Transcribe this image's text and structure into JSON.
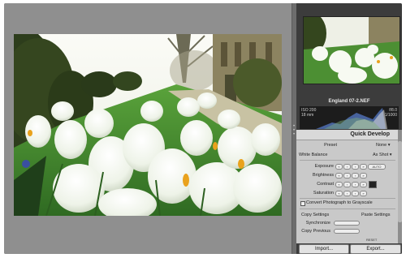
{
  "navigator": {
    "filename": "England 07-2.NEF"
  },
  "histogram": {
    "iso": "ISO 200",
    "focal": "18 mm",
    "aperture": "f/8.0",
    "shutter": "1/1000"
  },
  "quick_develop": {
    "title": "Quick Develop",
    "preset_label": "Preset",
    "preset_value": "None",
    "white_balance_label": "White Balance",
    "white_balance_value": "As Shot",
    "exposure_label": "Exposure",
    "brightness_label": "Brightness",
    "contrast_label": "Contrast",
    "saturation_label": "Saturation",
    "auto_label": "AUTO",
    "grayscale_label": "Convert Photograph to Grayscale",
    "copy_settings_label": "Copy Settings",
    "paste_settings_label": "Paste Settings",
    "synchronize_label": "Synchronize",
    "copy_previous_label": "Copy Previous",
    "reset_label": "RESET"
  },
  "buttons": {
    "import": "Import...",
    "export": "Export..."
  },
  "step_glyphs": {
    "double_left": "«",
    "left": "‹",
    "right": "›",
    "double_right": "»",
    "menu_arrow": "▾"
  }
}
